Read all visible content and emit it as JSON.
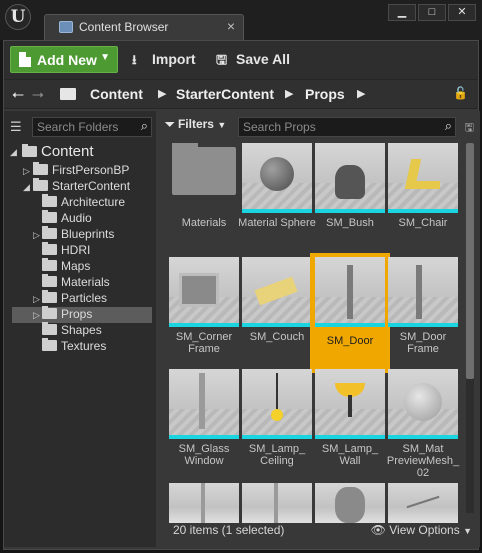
{
  "window": {
    "tab_title": "Content Browser",
    "close_glyph": "×",
    "minimize_glyph": "▁",
    "maximize_glyph": "□",
    "window_close_glyph": "✕"
  },
  "toolbar": {
    "add_new_label": "Add New",
    "import_label": "Import",
    "save_all_label": "Save All"
  },
  "path": {
    "crumbs": [
      "Content",
      "StarterContent",
      "Props"
    ]
  },
  "tree": {
    "search_placeholder": "Search Folders",
    "items": [
      {
        "label": "Content",
        "depth": 0,
        "expanded": true
      },
      {
        "label": "FirstPersonBP",
        "depth": 1,
        "collapsed": true
      },
      {
        "label": "StarterContent",
        "depth": 1,
        "expanded": true
      },
      {
        "label": "Architecture",
        "depth": 2
      },
      {
        "label": "Audio",
        "depth": 2
      },
      {
        "label": "Blueprints",
        "depth": 2,
        "collapsed": true
      },
      {
        "label": "HDRI",
        "depth": 2
      },
      {
        "label": "Maps",
        "depth": 2
      },
      {
        "label": "Materials",
        "depth": 2
      },
      {
        "label": "Particles",
        "depth": 2,
        "collapsed": true
      },
      {
        "label": "Props",
        "depth": 2,
        "collapsed": true,
        "selected": true
      },
      {
        "label": "Shapes",
        "depth": 2
      },
      {
        "label": "Textures",
        "depth": 2
      }
    ]
  },
  "assets": {
    "filters_label": "Filters",
    "search_placeholder": "Search Props",
    "tiles": [
      {
        "label": "Materials",
        "kind": "folder"
      },
      {
        "label": "Material Sphere"
      },
      {
        "label": "SM_Bush"
      },
      {
        "label": "SM_Chair"
      },
      {
        "label": "SM_Corner Frame"
      },
      {
        "label": "SM_Couch"
      },
      {
        "label": "SM_Door",
        "selected": true
      },
      {
        "label": "SM_Door Frame"
      },
      {
        "label": "SM_Glass Window"
      },
      {
        "label": "SM_Lamp_ Ceiling"
      },
      {
        "label": "SM_Lamp_ Wall"
      },
      {
        "label": "SM_Mat PreviewMesh_ 02"
      }
    ],
    "status_text": "20 items (1 selected)",
    "view_options_label": "View Options"
  },
  "colors": {
    "accent_green": "#4e9a32",
    "selection_orange": "#f0a800",
    "asset_bar_cyan": "#1ad5e0"
  }
}
